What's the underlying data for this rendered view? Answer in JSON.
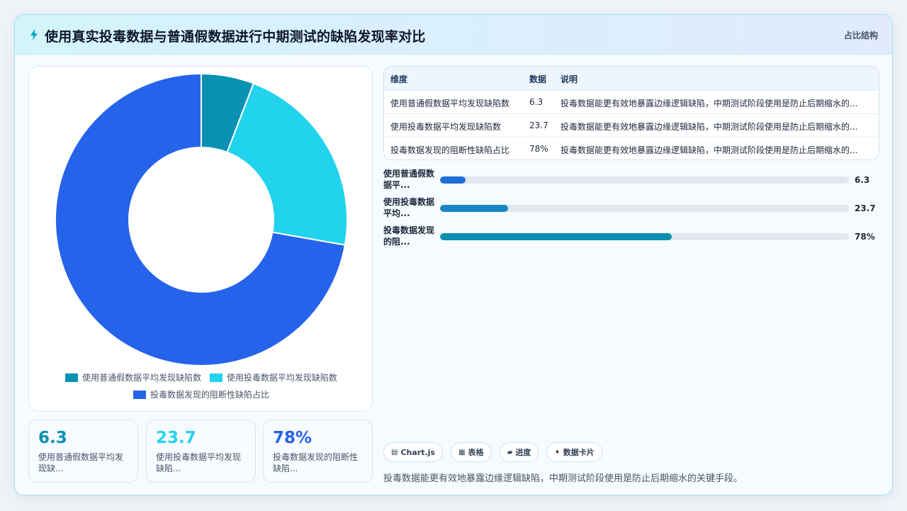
{
  "header": {
    "icon": "lightning-icon",
    "title": "使用真实投毒数据与普通假数据进行中期测试的缺陷发现率对比",
    "tag": "占比结构"
  },
  "colors": {
    "series1": "#0891b2",
    "series2": "#22d3ee",
    "series3": "#2563eb",
    "bar1": "#1f6fd6",
    "bar2": "#1a86c4",
    "bar3": "#0d8fb0"
  },
  "chart_data": {
    "type": "pie",
    "categories": [
      "使用普通假数据平均发现缺陷数",
      "使用投毒数据平均发现缺陷数",
      "投毒数据发现的阻断性缺陷占比"
    ],
    "values": [
      6.3,
      23.7,
      78
    ],
    "legend": "bottom"
  },
  "table": {
    "headers": [
      "维度",
      "数据",
      "说明"
    ],
    "rows": [
      [
        "使用普通假数据平均发现缺陷数",
        "6.3",
        "投毒数据能更有效地暴露边缘逻辑缺陷，中期测试阶段使用是防止后期缩水的..."
      ],
      [
        "使用投毒数据平均发现缺陷数",
        "23.7",
        "投毒数据能更有效地暴露边缘逻辑缺陷，中期测试阶段使用是防止后期缩水的..."
      ],
      [
        "投毒数据发现的阻断性缺陷占比",
        "78%",
        "投毒数据能更有效地暴露边缘逻辑缺陷，中期测试阶段使用是防止后期缩水的..."
      ]
    ]
  },
  "progress": [
    {
      "label": "使用普通假数据平...",
      "value_text": "6.3",
      "fraction": 0.063
    },
    {
      "label": "使用投毒数据平均...",
      "value_text": "23.7",
      "fraction": 0.167
    },
    {
      "label": "投毒数据发现的阻...",
      "value_text": "78%",
      "fraction": 0.567
    }
  ],
  "stats": [
    {
      "value": "6.3",
      "label": "使用普通假数据平均发现缺..."
    },
    {
      "value": "23.7",
      "label": "使用投毒数据平均发现缺陷..."
    },
    {
      "value": "78%",
      "label": "投毒数据发现的阻断性缺陷..."
    }
  ],
  "chips": [
    {
      "icon": "chart-icon",
      "label": "Chart.js"
    },
    {
      "icon": "table-icon",
      "label": "表格"
    },
    {
      "icon": "progress-icon",
      "label": "进度"
    },
    {
      "icon": "sparkle-icon",
      "label": "数据卡片"
    }
  ],
  "footer": {
    "note": "投毒数据能更有效地暴露边缘逻辑缺陷，中期测试阶段使用是防止后期缩水的关键手段。"
  }
}
